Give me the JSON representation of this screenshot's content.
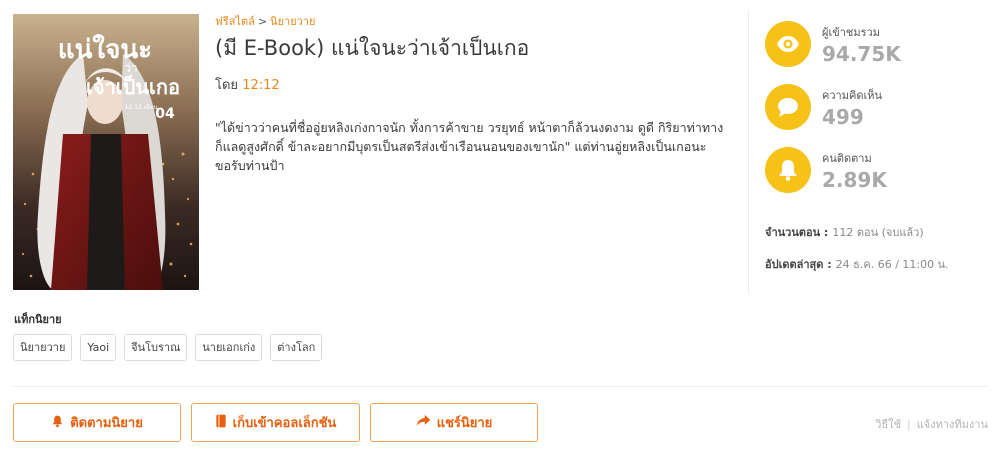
{
  "breadcrumb": {
    "category": "ฟรีสไตล์",
    "separator": ">",
    "subcategory": "นิยายวาย"
  },
  "novel": {
    "title": "(มี E-Book) แน่ใจนะว่าเจ้าเป็นเกอ",
    "author_prefix": "โดย",
    "author_name": "12:12",
    "synopsis": "\"ได้ข่าวว่าคนที่ชื่ออู่ยหลิงเก่งกาจนัก ทั้งการค้าขาย วรยุทธ์ หน้าตาก็ล้วนงดงาม ดูดี กิริยาท่าทางก็แลดูสูงศักดิ์ ข้าละอยากมีบุตรเป็นสตรีส่งเข้าเรือนนอนของเขานัก\" แต่ท่านอู่ยหลิงเป็นเกอนะขอรับท่านป้า"
  },
  "cover": {
    "title_line1": "แน่ใจนะ",
    "title_line2": "ว่า",
    "title_line3": "เจ้าเป็นเกอ",
    "author": "12:12 เขียน",
    "volume": "04"
  },
  "stats": [
    {
      "icon": "eye-icon",
      "label": "ผู้เข้าชมรวม",
      "value": "94.75K"
    },
    {
      "icon": "comment-icon",
      "label": "ความคิดเห็น",
      "value": "499"
    },
    {
      "icon": "bell-icon",
      "label": "คนติดตาม",
      "value": "2.89K"
    }
  ],
  "meta": {
    "episodes_label": "จำนวนตอน :",
    "episodes_value": "112 ตอน (จบแล้ว)",
    "updated_label": "อัปเดตล่าสุด :",
    "updated_value": "24 ธ.ค. 66 / 11:00 น."
  },
  "tags_title": "แท็กนิยาย",
  "tags": [
    "นิยายวาย",
    "Yaoi",
    "จีนโบราณ",
    "นายเอกเก่ง",
    "ต่างโลก"
  ],
  "actions": {
    "follow": "ติดตามนิยาย",
    "collect": "เก็บเข้าคอลเล็กชัน",
    "share": "แชร์นิยาย"
  },
  "footer": {
    "guide": "วิธีใช้",
    "separator": "|",
    "report": "แจ้งทางทีมงาน"
  },
  "colors": {
    "accent": "#e8871b",
    "button_text": "#e8600f",
    "stat_circle": "#f7c218"
  }
}
